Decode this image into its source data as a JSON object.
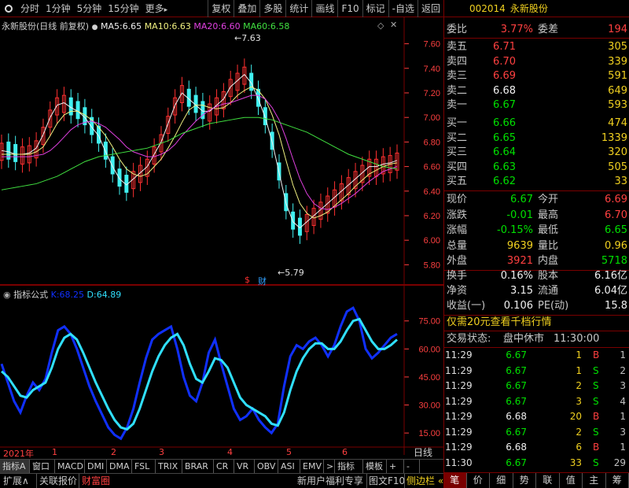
{
  "toolbar": {
    "items": [
      "分时",
      "1分钟",
      "5分钟",
      "15分钟",
      "更多"
    ],
    "more_arrow": "▸",
    "right": [
      "复权",
      "叠加",
      "多股",
      "统计",
      "画线",
      "F10",
      "标记",
      "-自选",
      "返回"
    ]
  },
  "stock": {
    "code": "002014",
    "name": "永新股份"
  },
  "main_chart": {
    "title": "永新股份(日线 前复权)",
    "ma5_label": "MA5:",
    "ma5": "6.65",
    "ma10_label": "MA10:",
    "ma10": "6.63",
    "ma20_label": "MA20:",
    "ma20": "6.60",
    "ma60_label": "MA60:",
    "ma60": "6.58",
    "high_mark": "7.63",
    "low_mark": "5.79",
    "cai": "财",
    "dollar": "$",
    "diamond": "◇",
    "circle_dot": "●"
  },
  "indicator": {
    "title": "指标公式",
    "k_label": "K:",
    "k": "68.25",
    "d_label": "D:",
    "d": "64.89"
  },
  "colors": {
    "ma5": "#f0f0f0",
    "ma10": "#f0f080",
    "ma20": "#e040e0",
    "ma60": "#40e040",
    "k": "#1030ff",
    "d": "#30e0ff",
    "up": "#ff3030",
    "down": "#40f0f0",
    "axis": "#ff4040",
    "border": "#7a0000"
  },
  "chart_data": [
    {
      "type": "line",
      "name": "price",
      "ylim": [
        5.7,
        7.7
      ],
      "yticks": [
        "7.60",
        "7.40",
        "7.20",
        "7.00",
        "6.80",
        "6.60",
        "6.40",
        "6.20",
        "6.00",
        "5.80"
      ],
      "series": [
        {
          "name": "MA5",
          "values": [
            6.73,
            6.72,
            6.7,
            6.7,
            6.71,
            6.75,
            6.86,
            7.0,
            7.1,
            7.12,
            7.08,
            7.05,
            7.0,
            6.92,
            6.85,
            6.72,
            6.6,
            6.5,
            6.45,
            6.5,
            6.55,
            6.6,
            6.7,
            6.8,
            6.95,
            7.1,
            7.2,
            7.15,
            7.1,
            7.05,
            7.05,
            7.1,
            7.15,
            7.25,
            7.3,
            7.35,
            7.28,
            7.15,
            7.0,
            6.8,
            6.55,
            6.3,
            6.15,
            6.1,
            6.15,
            6.2,
            6.25,
            6.3,
            6.35,
            6.4,
            6.45,
            6.5,
            6.55,
            6.6,
            6.6,
            6.62,
            6.63,
            6.65
          ]
        },
        {
          "name": "MA10",
          "values": [
            6.7,
            6.7,
            6.7,
            6.7,
            6.7,
            6.72,
            6.76,
            6.85,
            6.95,
            7.02,
            7.05,
            7.05,
            7.02,
            6.98,
            6.92,
            6.85,
            6.76,
            6.66,
            6.58,
            6.54,
            6.52,
            6.54,
            6.6,
            6.66,
            6.75,
            6.85,
            6.96,
            7.06,
            7.1,
            7.1,
            7.08,
            7.07,
            7.08,
            7.12,
            7.18,
            7.22,
            7.25,
            7.22,
            7.15,
            7.02,
            6.86,
            6.65,
            6.45,
            6.3,
            6.22,
            6.18,
            6.2,
            6.23,
            6.28,
            6.33,
            6.38,
            6.44,
            6.49,
            6.54,
            6.57,
            6.6,
            6.62,
            6.63
          ]
        },
        {
          "name": "MA20",
          "values": [
            6.68,
            6.68,
            6.68,
            6.68,
            6.68,
            6.69,
            6.7,
            6.73,
            6.78,
            6.84,
            6.9,
            6.94,
            6.96,
            6.97,
            6.95,
            6.92,
            6.87,
            6.82,
            6.76,
            6.72,
            6.7,
            6.68,
            6.68,
            6.7,
            6.73,
            6.78,
            6.85,
            6.91,
            6.97,
            7.02,
            7.06,
            7.09,
            7.11,
            7.12,
            7.14,
            7.16,
            7.18,
            7.18,
            7.15,
            7.08,
            6.98,
            6.83,
            6.66,
            6.5,
            6.38,
            6.3,
            6.26,
            6.25,
            6.27,
            6.3,
            6.34,
            6.38,
            6.43,
            6.48,
            6.52,
            6.56,
            6.58,
            6.6
          ]
        },
        {
          "name": "MA60",
          "values": [
            6.41,
            6.42,
            6.43,
            6.44,
            6.45,
            6.46,
            6.48,
            6.5,
            6.52,
            6.55,
            6.58,
            6.61,
            6.64,
            6.66,
            6.68,
            6.69,
            6.7,
            6.71,
            6.72,
            6.73,
            6.74,
            6.75,
            6.77,
            6.79,
            6.81,
            6.84,
            6.87,
            6.89,
            6.91,
            6.93,
            6.95,
            6.96,
            6.97,
            6.98,
            6.99,
            7.0,
            7.0,
            7.0,
            6.99,
            6.98,
            6.96,
            6.94,
            6.92,
            6.9,
            6.88,
            6.85,
            6.82,
            6.79,
            6.76,
            6.73,
            6.7,
            6.68,
            6.66,
            6.64,
            6.62,
            6.6,
            6.59,
            6.58
          ]
        }
      ]
    },
    {
      "type": "line",
      "name": "KDJ",
      "ylim": [
        10,
        85
      ],
      "yticks": [
        "75.00",
        "60.00",
        "45.00",
        "30.00",
        "15.00"
      ],
      "series": [
        {
          "name": "K",
          "values": [
            52,
            42,
            32,
            26,
            35,
            42,
            38,
            44,
            58,
            70,
            72,
            68,
            60,
            50,
            40,
            32,
            25,
            18,
            14,
            12,
            18,
            28,
            42,
            55,
            65,
            68,
            70,
            72,
            60,
            45,
            35,
            32,
            42,
            58,
            65,
            52,
            40,
            28,
            22,
            24,
            28,
            22,
            18,
            15,
            20,
            40,
            56,
            62,
            60,
            64,
            66,
            62,
            56,
            62,
            72,
            80,
            82,
            75,
            60,
            55,
            58,
            62,
            66,
            68
          ]
        },
        {
          "name": "D",
          "values": [
            48,
            45,
            40,
            35,
            34,
            38,
            40,
            42,
            50,
            60,
            66,
            68,
            65,
            58,
            50,
            42,
            35,
            28,
            22,
            18,
            17,
            20,
            28,
            38,
            48,
            56,
            62,
            66,
            68,
            62,
            52,
            44,
            42,
            48,
            55,
            54,
            50,
            42,
            34,
            30,
            28,
            26,
            24,
            20,
            19,
            26,
            38,
            48,
            55,
            60,
            63,
            63,
            60,
            60,
            64,
            70,
            75,
            76,
            70,
            64,
            60,
            60,
            62,
            65
          ]
        }
      ]
    }
  ],
  "axis_bottom": {
    "year": "2021年",
    "months": [
      "1",
      "2",
      "3",
      "4",
      "5",
      "6"
    ],
    "period": "日线"
  },
  "quote": {
    "weibi_label": "委比",
    "weibi": "3.77%",
    "weicha_label": "委差",
    "weicha": "194",
    "sell": [
      {
        "label": "卖五",
        "price": "6.71",
        "vol": "305"
      },
      {
        "label": "卖四",
        "price": "6.70",
        "vol": "339"
      },
      {
        "label": "卖三",
        "price": "6.69",
        "vol": "591"
      },
      {
        "label": "卖二",
        "price": "6.68",
        "vol": "649"
      },
      {
        "label": "卖一",
        "price": "6.67",
        "vol": "593"
      }
    ],
    "buy": [
      {
        "label": "买一",
        "price": "6.66",
        "vol": "474"
      },
      {
        "label": "买二",
        "price": "6.65",
        "vol": "1339"
      },
      {
        "label": "买三",
        "price": "6.64",
        "vol": "320"
      },
      {
        "label": "买四",
        "price": "6.63",
        "vol": "505"
      },
      {
        "label": "买五",
        "price": "6.62",
        "vol": "33"
      }
    ],
    "stats": [
      {
        "l": "现价",
        "v": "6.67",
        "vc": "grn",
        "l2": "今开",
        "v2": "6.69",
        "v2c": "red"
      },
      {
        "l": "涨跌",
        "v": "-0.01",
        "vc": "grn",
        "l2": "最高",
        "v2": "6.70",
        "v2c": "red"
      },
      {
        "l": "涨幅",
        "v": "-0.15%",
        "vc": "grn",
        "l2": "最低",
        "v2": "6.65",
        "v2c": "grn"
      },
      {
        "l": "总量",
        "v": "9639",
        "vc": "yel",
        "l2": "量比",
        "v2": "0.96",
        "v2c": "yel"
      },
      {
        "l": "外盘",
        "v": "3921",
        "vc": "red",
        "l2": "内盘",
        "v2": "5718",
        "v2c": "grn"
      }
    ],
    "stats2": [
      {
        "l": "换手",
        "v": "0.16%",
        "vc": "wht",
        "l2": "股本",
        "v2": "6.16亿",
        "v2c": "wht"
      },
      {
        "l": "净资",
        "v": "3.15",
        "vc": "wht",
        "l2": "流通",
        "v2": "6.04亿",
        "v2c": "wht"
      },
      {
        "l": "收益(一)",
        "v": "0.106",
        "vc": "wht",
        "l2": "PE(动)",
        "v2": "15.8",
        "v2c": "wht"
      }
    ],
    "promo": "仅需20元查看千档行情",
    "status_label": "交易状态:",
    "status": "盘中休市",
    "time": "11:30:00"
  },
  "trades": [
    {
      "t": "11:29",
      "p": "6.67",
      "pc": "grn",
      "v": "1",
      "f": "B",
      "fc": "red",
      "n": "1"
    },
    {
      "t": "11:29",
      "p": "6.67",
      "pc": "grn",
      "v": "1",
      "f": "S",
      "fc": "grn",
      "n": "2"
    },
    {
      "t": "11:29",
      "p": "6.67",
      "pc": "grn",
      "v": "2",
      "f": "S",
      "fc": "grn",
      "n": "3"
    },
    {
      "t": "11:29",
      "p": "6.67",
      "pc": "grn",
      "v": "3",
      "f": "S",
      "fc": "grn",
      "n": "4"
    },
    {
      "t": "11:29",
      "p": "6.68",
      "pc": "wht",
      "v": "20",
      "f": "B",
      "fc": "red",
      "n": "1"
    },
    {
      "t": "11:29",
      "p": "6.67",
      "pc": "grn",
      "v": "2",
      "f": "S",
      "fc": "grn",
      "n": "3"
    },
    {
      "t": "11:29",
      "p": "6.68",
      "pc": "wht",
      "v": "6",
      "f": "B",
      "fc": "red",
      "n": "1"
    },
    {
      "t": "11:30",
      "p": "6.67",
      "pc": "grn",
      "v": "33",
      "f": "S",
      "fc": "grn",
      "n": "29"
    }
  ],
  "indicator_tabs": [
    "指标A",
    "窗口",
    "MACD",
    "DMI",
    "DMA",
    "FSL",
    "TRIX",
    "BRAR",
    "CR",
    "VR",
    "OBV",
    "ASI",
    "EMV",
    ">",
    "指标B",
    "模板",
    "+",
    "-"
  ],
  "bottom_bar": {
    "items": [
      "扩展∧",
      "关联报价",
      "财富圈"
    ],
    "right": [
      "新用户福利专享",
      "图文F10",
      "侧边栏 «"
    ],
    "side": [
      "笔",
      "价",
      "细",
      "势",
      "联",
      "值",
      "主",
      "筹"
    ]
  }
}
